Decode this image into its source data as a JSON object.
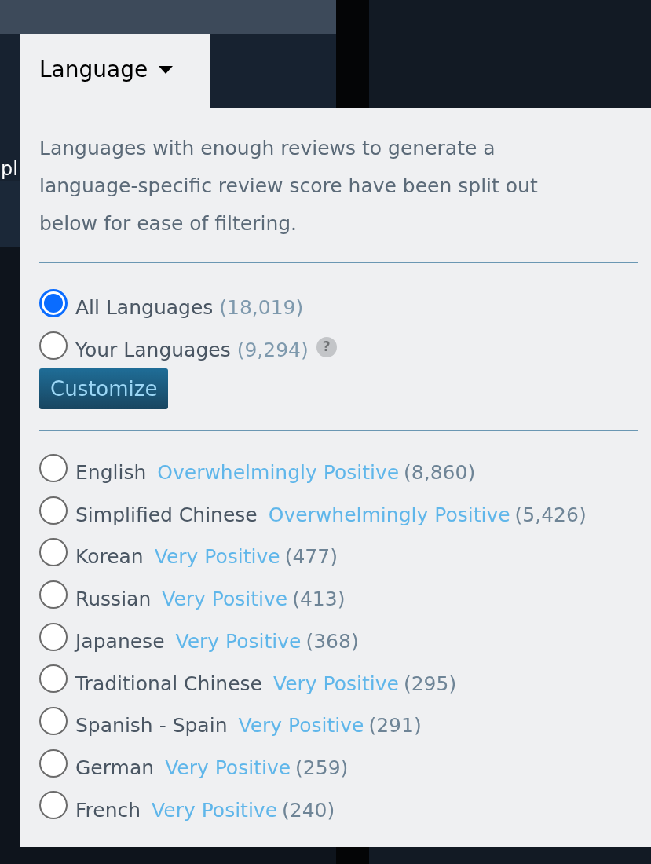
{
  "background_text": "pl",
  "dropdown": {
    "label": "Language",
    "description": "Languages with enough reviews to generate a language-specific review score have been split out below for ease of filtering.",
    "options": [
      {
        "label": "All Languages",
        "count": "(18,019)",
        "selected": true
      },
      {
        "label": "Your Languages",
        "count": "(9,294)",
        "selected": false,
        "help": "?"
      }
    ],
    "customize_button": "Customize",
    "languages": [
      {
        "label": "English",
        "rating": "Overwhelmingly Positive",
        "count": "(8,860)",
        "selected": false
      },
      {
        "label": "Simplified Chinese",
        "rating": "Overwhelmingly Positive",
        "count": "(5,426)",
        "selected": false
      },
      {
        "label": "Korean",
        "rating": "Very Positive",
        "count": "(477)",
        "selected": false
      },
      {
        "label": "Russian",
        "rating": "Very Positive",
        "count": "(413)",
        "selected": false
      },
      {
        "label": "Japanese",
        "rating": "Very Positive",
        "count": "(368)",
        "selected": false
      },
      {
        "label": "Traditional Chinese",
        "rating": "Very Positive",
        "count": "(295)",
        "selected": false
      },
      {
        "label": "Spanish - Spain",
        "rating": "Very Positive",
        "count": "(291)",
        "selected": false
      },
      {
        "label": "German",
        "rating": "Very Positive",
        "count": "(259)",
        "selected": false
      },
      {
        "label": "French",
        "rating": "Very Positive",
        "count": "(240)",
        "selected": false
      }
    ]
  }
}
